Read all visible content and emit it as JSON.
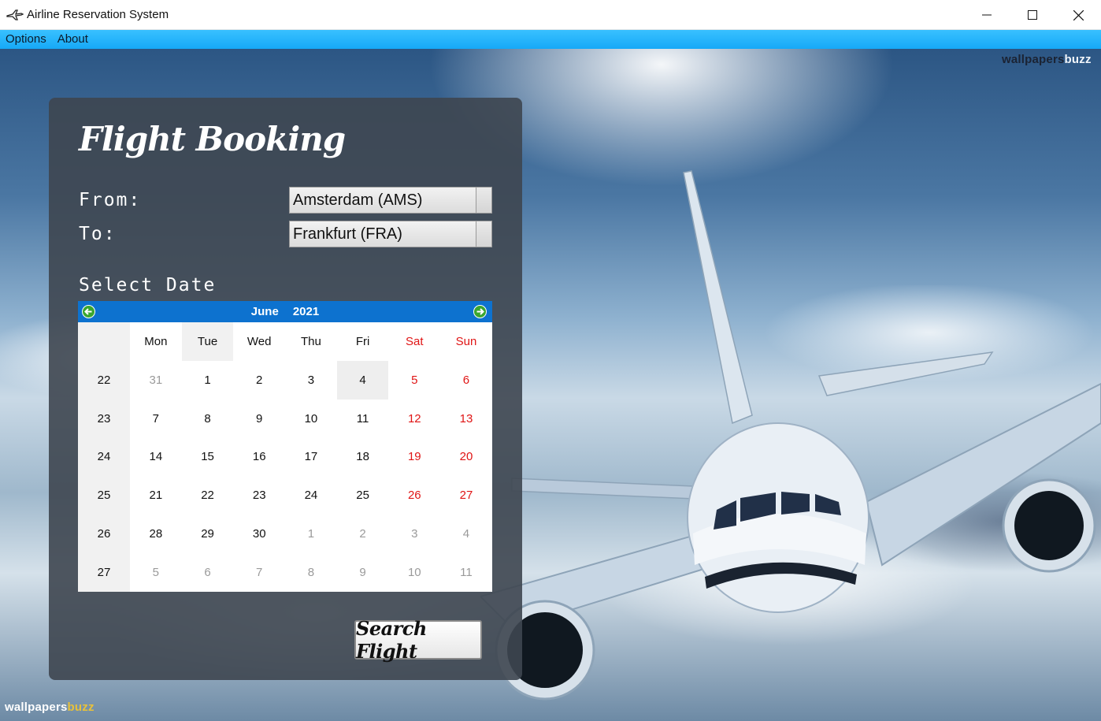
{
  "window": {
    "title": "Airline Reservation System",
    "controls": {
      "minimize": "minimize",
      "maximize": "maximize",
      "close": "close"
    }
  },
  "menu": {
    "items": [
      "Options",
      "About"
    ]
  },
  "watermark": {
    "word1": "wallpapers",
    "word2": "buzz"
  },
  "booking": {
    "title": "Flight Booking",
    "from_label": "From:",
    "to_label": "To:",
    "from_value": "Amsterdam (AMS)",
    "to_value": "Frankfurt (FRA)",
    "date_label": "Select Date",
    "search_label": "Search Flight"
  },
  "calendar": {
    "month": "June",
    "year": "2021",
    "day_names": [
      "Mon",
      "Tue",
      "Wed",
      "Thu",
      "Fri",
      "Sat",
      "Sun"
    ],
    "weeks": [
      {
        "week": "22",
        "days": [
          "31",
          "1",
          "2",
          "3",
          "4",
          "5",
          "6"
        ]
      },
      {
        "week": "23",
        "days": [
          "7",
          "8",
          "9",
          "10",
          "11",
          "12",
          "13"
        ]
      },
      {
        "week": "24",
        "days": [
          "14",
          "15",
          "16",
          "17",
          "18",
          "19",
          "20"
        ]
      },
      {
        "week": "25",
        "days": [
          "21",
          "22",
          "23",
          "24",
          "25",
          "26",
          "27"
        ]
      },
      {
        "week": "26",
        "days": [
          "28",
          "29",
          "30",
          "1",
          "2",
          "3",
          "4"
        ]
      },
      {
        "week": "27",
        "days": [
          "5",
          "6",
          "7",
          "8",
          "9",
          "10",
          "11"
        ]
      }
    ],
    "selected_day": "4",
    "colors": {
      "header": "#0d72cf",
      "weekend": "#e01515",
      "other_month": "#9a9a9a"
    }
  },
  "colors": {
    "menubar": "#16a9f7",
    "panel": "#3e4650"
  }
}
